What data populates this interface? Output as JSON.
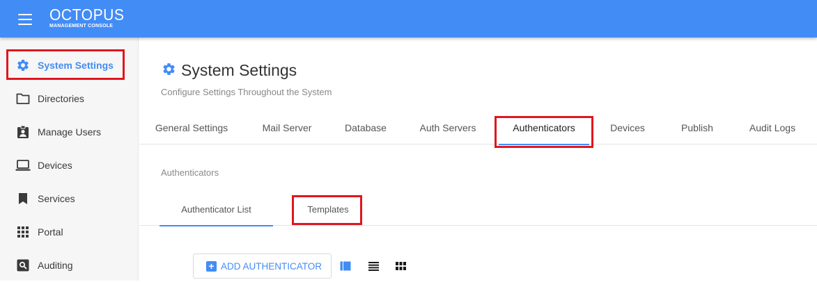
{
  "header": {
    "logo_main": "OCTOPUS",
    "logo_sub": "MANAGEMENT CONSOLE"
  },
  "sidebar": {
    "items": [
      {
        "label": "System Settings",
        "icon": "gear-icon",
        "active": true
      },
      {
        "label": "Directories",
        "icon": "folder-icon"
      },
      {
        "label": "Manage Users",
        "icon": "user-badge-icon"
      },
      {
        "label": "Devices",
        "icon": "laptop-icon"
      },
      {
        "label": "Services",
        "icon": "bookmark-icon"
      },
      {
        "label": "Portal",
        "icon": "grid-icon"
      },
      {
        "label": "Auditing",
        "icon": "search-box-icon"
      }
    ]
  },
  "main": {
    "title": "System Settings",
    "subtitle": "Configure Settings Throughout the System",
    "tabs": [
      {
        "label": "General Settings"
      },
      {
        "label": "Mail Server"
      },
      {
        "label": "Database"
      },
      {
        "label": "Auth Servers"
      },
      {
        "label": "Authenticators",
        "active": true
      },
      {
        "label": "Devices"
      },
      {
        "label": "Publish"
      },
      {
        "label": "Audit Logs"
      }
    ],
    "section_label": "Authenticators",
    "subtabs": [
      {
        "label": "Authenticator List",
        "active": true
      },
      {
        "label": "Templates"
      }
    ],
    "add_button_label": "ADD AUTHENTICATOR",
    "view_icons": [
      "card-view-icon",
      "list-view-icon",
      "grid-view-icon"
    ]
  },
  "colors": {
    "accent": "#428cf6",
    "highlight": "#e0161e"
  }
}
